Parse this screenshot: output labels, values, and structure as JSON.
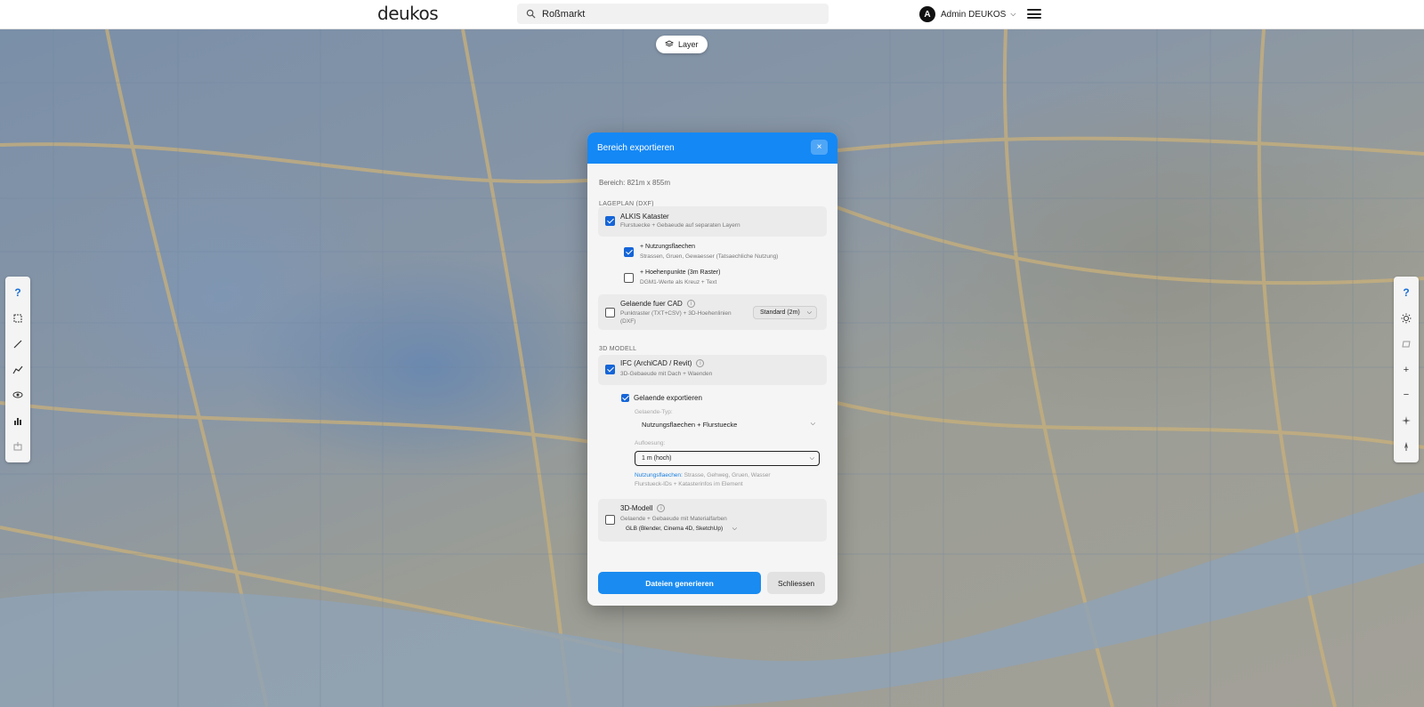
{
  "header": {
    "logo": "deukos",
    "search_value": "Roßmarkt",
    "user_initial": "A",
    "user_name": "Admin DEUKOS"
  },
  "map": {
    "layer_button": "Layer",
    "left_tools": [
      "help-icon",
      "rectangle-select-icon",
      "line-measure-icon",
      "profile-icon",
      "eye-icon",
      "chart-icon",
      "export-icon"
    ],
    "right_tools": [
      "help-icon",
      "sun-icon",
      "layers-3d-icon",
      "zoom-in-icon",
      "zoom-out-icon",
      "compass-icon",
      "north-arrow-icon"
    ]
  },
  "modal": {
    "title": "Bereich exportieren",
    "close": "×",
    "range": "Bereich: 821m x 855m",
    "section_lageplan": "LAGEPLAN (DXF)",
    "alkis": {
      "title": "ALKIS Kataster",
      "sub": "Flurstuecke + Gebaeude auf separaten Layern",
      "checked": true
    },
    "nutzung": {
      "title": "+ Nutzungsflaechen",
      "sub": "Strassen, Gruen, Gewaesser (Tatsaechliche Nutzung)",
      "checked": true
    },
    "hoehen": {
      "title": "+ Hoehenpunkte (3m Raster)",
      "sub": "DGM1-Werte als Kreuz + Text",
      "checked": false
    },
    "gelaende_cad": {
      "title": "Gelaende fuer CAD",
      "sub1": "Punktraster (TXT+CSV) + 3D-Hoehenlinien",
      "sub2": "(DXF)",
      "select": "Standard (2m)",
      "checked": false
    },
    "section_3d": "3D MODELL",
    "ifc": {
      "title": "IFC (ArchiCAD / Revit)",
      "sub": "3D-Gebaeude mit Dach + Waenden",
      "checked": true
    },
    "gelaende_export": {
      "title": "Gelaende exportieren",
      "checked": true
    },
    "gelaende_typ_label": "Gelaende-Typ:",
    "gelaende_typ_value": "Nutzungsflaechen + Flurstuecke",
    "aufloesung_label": "Aufloesung:",
    "aufloesung_value": "1 m (hoch)",
    "note_key": "Nutzungsflaechen:",
    "note_rest": " Strasse, Gehweg, Gruen, Wasser",
    "note_line2": "Flurstueck-IDs + Katasterinfos im Element",
    "modell3d": {
      "title": "3D-Modell",
      "sub": "Gelaende + Gebaeude mit Materialfarben",
      "format": "GLB (Blender, Cinema 4D, SketchUp)",
      "checked": false
    },
    "generate": "Dateien generieren",
    "close_button": "Schliessen"
  },
  "colors": {
    "accent": "#1488f5",
    "primary_button": "#1a8bf0",
    "checkbox": "#1565d8"
  }
}
